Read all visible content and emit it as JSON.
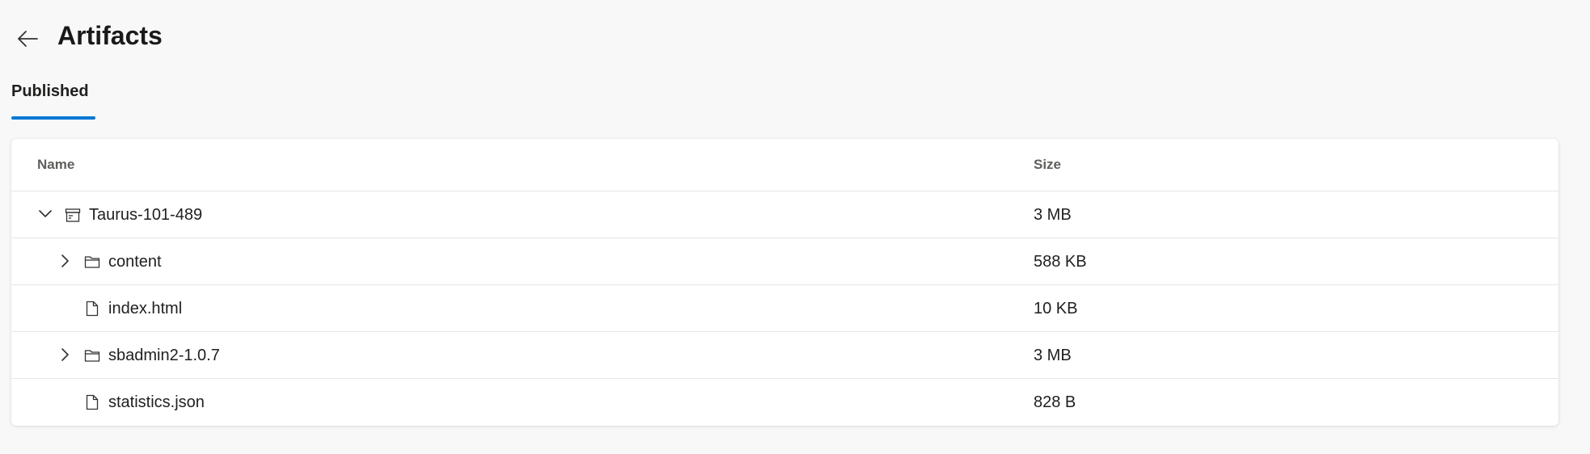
{
  "header": {
    "back_icon": "arrow-left-icon",
    "title": "Artifacts"
  },
  "tabs": [
    {
      "label": "Published",
      "selected": true
    }
  ],
  "table": {
    "columns": {
      "name": "Name",
      "size": "Size"
    },
    "rows": [
      {
        "name": "Taurus-101-489",
        "size": "3 MB",
        "icon": "artifact-package-icon",
        "chevron": "chevron-down-icon",
        "expanded": true,
        "level": 0
      },
      {
        "name": "content",
        "size": "588 KB",
        "icon": "folder-icon",
        "chevron": "chevron-right-icon",
        "expanded": false,
        "level": 1
      },
      {
        "name": "index.html",
        "size": "10 KB",
        "icon": "file-icon",
        "chevron": "",
        "level": 1
      },
      {
        "name": "sbadmin2-1.0.7",
        "size": "3 MB",
        "icon": "folder-icon",
        "chevron": "chevron-right-icon",
        "expanded": false,
        "level": 1
      },
      {
        "name": "statistics.json",
        "size": "828 B",
        "icon": "file-icon",
        "chevron": "",
        "level": 1
      }
    ]
  },
  "colors": {
    "accent": "#0078d4",
    "background": "#f8f8f8",
    "card": "#ffffff"
  }
}
